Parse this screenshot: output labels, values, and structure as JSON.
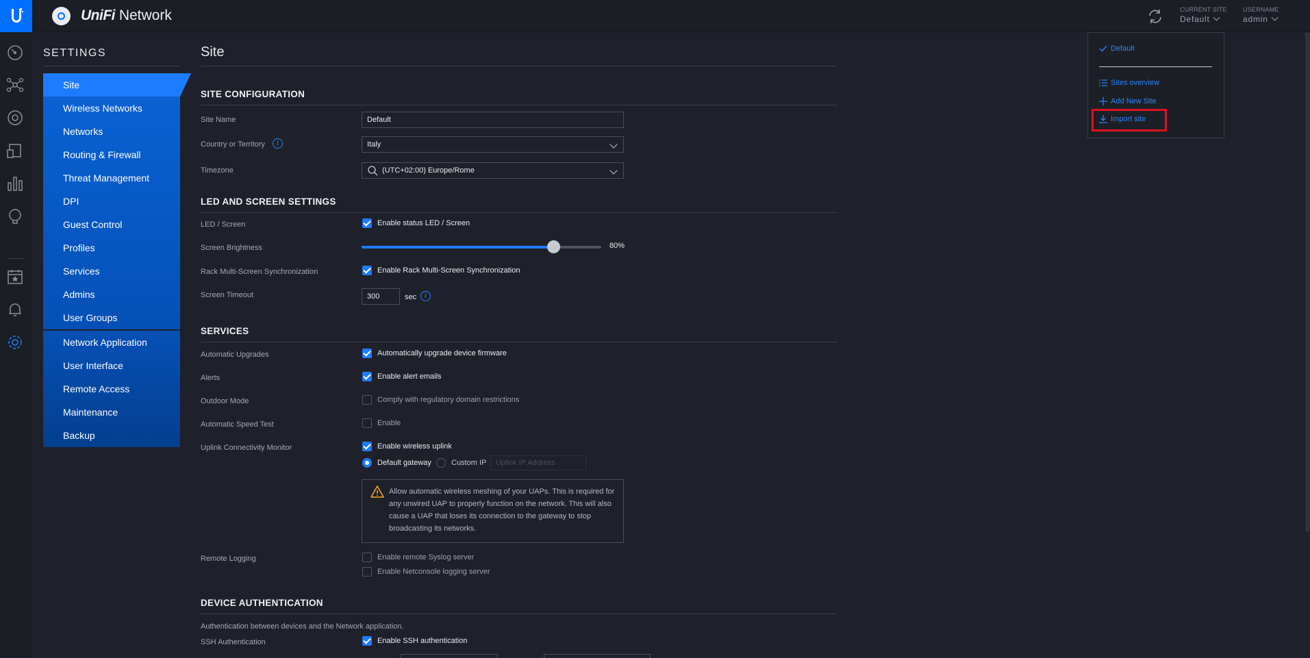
{
  "app": {
    "name_prefix": "UniFi",
    "name_suffix": " Network"
  },
  "header": {
    "current_site_label": "CURRENT SITE",
    "current_site_value": "Default",
    "username_label": "USERNAME",
    "username_value": "admin"
  },
  "site_menu": {
    "current": "Default",
    "items": [
      "Sites overview",
      "Add New Site",
      "Import site"
    ]
  },
  "settings": {
    "title": "SETTINGS",
    "nav_group1": [
      "Site",
      "Wireless Networks",
      "Networks",
      "Routing & Firewall",
      "Threat Management",
      "DPI",
      "Guest Control",
      "Profiles",
      "Services",
      "Admins",
      "User Groups"
    ],
    "nav_group2": [
      "Network Application",
      "User Interface",
      "Remote Access",
      "Maintenance",
      "Backup"
    ],
    "active": "Site"
  },
  "page": {
    "title": "Site"
  },
  "site_config": {
    "title": "SITE CONFIGURATION",
    "site_name_label": "Site Name",
    "site_name_value": "Default",
    "country_label": "Country or Territory",
    "country_value": "Italy",
    "timezone_label": "Timezone",
    "timezone_value": "(UTC+02:00) Europe/Rome"
  },
  "led": {
    "title": "LED AND SCREEN SETTINGS",
    "led_label": "LED / Screen",
    "led_option": "Enable status LED / Screen",
    "led_checked": true,
    "brightness_label": "Screen Brightness",
    "brightness_value": "80%",
    "brightness_level": 0.8,
    "rack_label": "Rack Multi-Screen Synchronization",
    "rack_option": "Enable Rack Multi-Screen Synchronization",
    "rack_checked": true,
    "timeout_label": "Screen Timeout",
    "timeout_value": "300",
    "timeout_unit": "sec"
  },
  "services": {
    "title": "SERVICES",
    "auto_upgrade_label": "Automatic Upgrades",
    "auto_upgrade_option": "Automatically upgrade device firmware",
    "alerts_label": "Alerts",
    "alerts_option": "Enable alert emails",
    "outdoor_label": "Outdoor Mode",
    "outdoor_option": "Comply with regulatory domain restrictions",
    "speedtest_label": "Automatic Speed Test",
    "speedtest_option": "Enable",
    "uplink_label": "Uplink Connectivity Monitor",
    "uplink_option": "Enable wireless uplink",
    "gateway_option": "Default gateway",
    "custom_ip_option": "Custom IP",
    "uplink_ip_placeholder": "Uplink IP Address",
    "warning": "Allow automatic wireless meshing of your UAPs. This is required for any unwired UAP to properly function on the network. This will also cause a UAP that loses its connection to the gateway to stop broadcasting its networks.",
    "remote_logging_label": "Remote Logging",
    "syslog_option": "Enable remote Syslog server",
    "netconsole_option": "Enable Netconsole logging server"
  },
  "device_auth": {
    "title": "DEVICE AUTHENTICATION",
    "description": "Authentication between devices and the Network application.",
    "ssh_label": "SSH Authentication",
    "ssh_option": "Enable SSH authentication"
  },
  "colors": {
    "accent": "#1f7bff",
    "brand": "#006fff",
    "highlight": "#e0101f",
    "background": "#1e2129"
  }
}
